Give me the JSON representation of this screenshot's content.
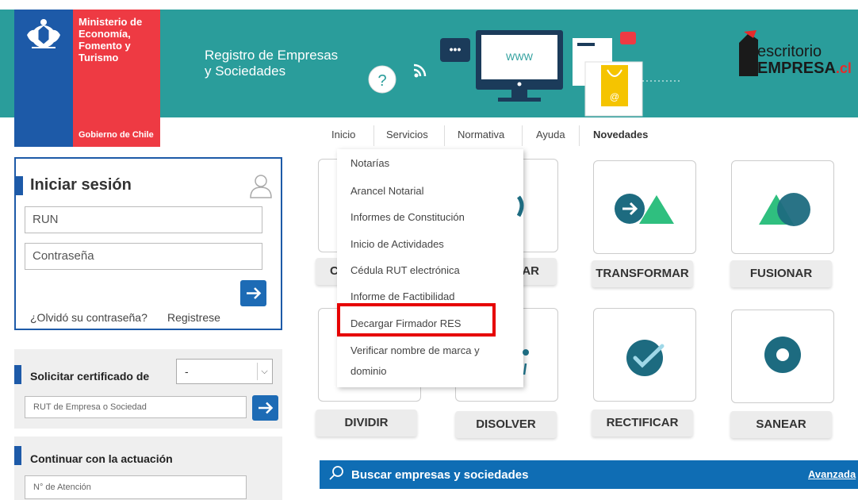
{
  "header": {
    "ministry": [
      "Ministerio de",
      "Economía,",
      "Fomento y",
      "Turismo"
    ],
    "government": "Gobierno de Chile",
    "registry_title": [
      "Registro de Empresas",
      "y Sociedades"
    ],
    "hero": {
      "monitor_text": "WWW",
      "help_glyph": "?",
      "chat_glyph": "•••",
      "envelope_glyph": "@"
    },
    "logo": {
      "line1": "escritorio",
      "line2": "EMPRESA",
      "suffix": ".cl"
    }
  },
  "nav": {
    "items": [
      "Inicio",
      "Servicios",
      "Normativa",
      "Ayuda",
      "Novedades"
    ]
  },
  "login": {
    "title": "Iniciar sesión",
    "run_placeholder": "RUN",
    "password_placeholder": "Contraseña",
    "forgot": "¿Olvidó su contraseña?",
    "register": "Registrese"
  },
  "certificate": {
    "title": "Solicitar certificado de",
    "selected": "-",
    "rut_placeholder": "RUT de Empresa o Sociedad"
  },
  "continue": {
    "title": "Continuar con la actuación",
    "attention_placeholder": "N° de Atención"
  },
  "tiles": {
    "row1": [
      "C",
      "AR",
      "TRANSFORMAR",
      "FUSIONAR"
    ],
    "row2": [
      "DIVIDIR",
      "DISOLVER",
      "RECTIFICAR",
      "SANEAR"
    ]
  },
  "dropdown": {
    "items": [
      "Notarías",
      "Arancel Notarial",
      "Informes de Constitución",
      "Inicio de Actividades",
      "Cédula RUT electrónica",
      "Informe de Factibilidad",
      "Decargar Firmador RES",
      "Verificar nombre de marca y",
      "dominio"
    ]
  },
  "search": {
    "label": "Buscar empresas y sociedades",
    "advanced": "Avanzada"
  },
  "colors": {
    "teal": "#2a9d9b",
    "gov_blue": "#1d5aa8",
    "gov_red": "#ee3a43",
    "search_blue": "#0f6db4",
    "highlight_red": "#e60000"
  }
}
